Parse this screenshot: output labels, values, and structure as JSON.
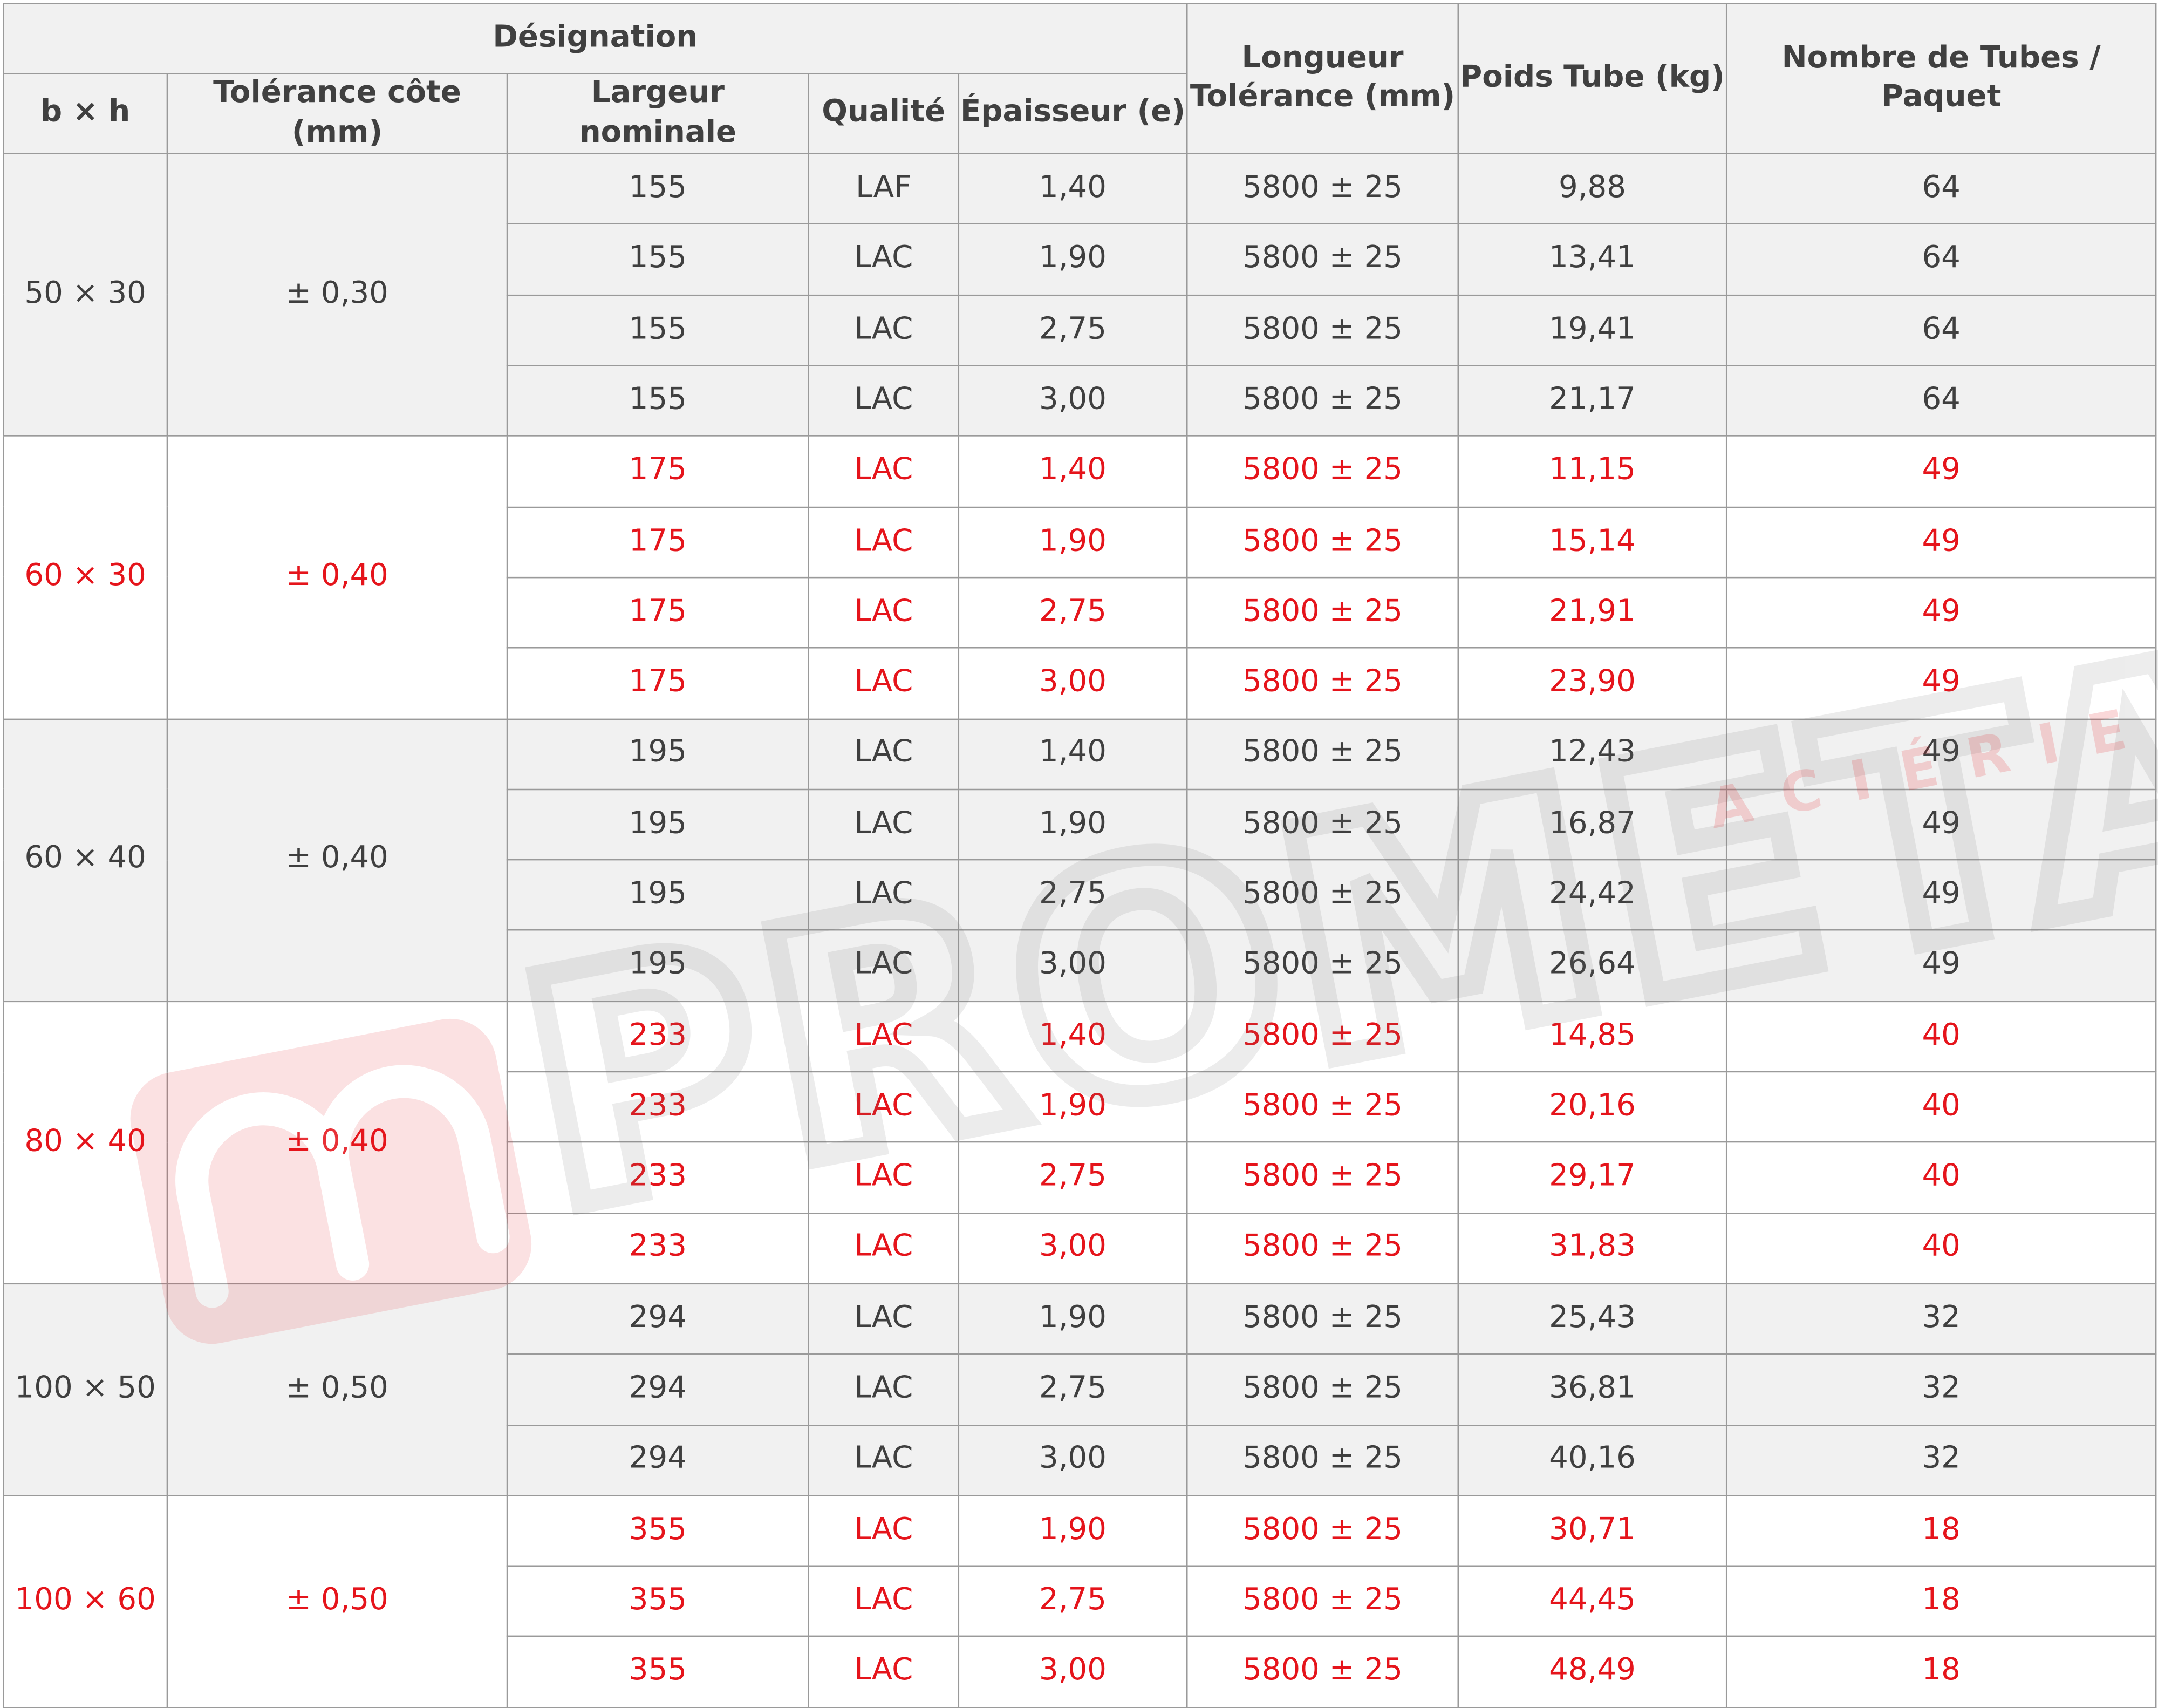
{
  "headers": {
    "designation": "Désignation",
    "bxh": "b × h",
    "tolerance_cote": "Tolérance côte (mm)",
    "largeur_nominale": "Largeur nominale",
    "qualite": "Qualité",
    "epaisseur": "Épaisseur (e)",
    "longueur_line1": "Longueur",
    "longueur_line2": "Tolérance (mm)",
    "poids": "Poids Tube (kg)",
    "nombre": "Nombre de Tubes / Paquet"
  },
  "groups": [
    {
      "bxh": "50 × 30",
      "tolerance": "± 0,30",
      "style": "gray",
      "rows": [
        {
          "largeur": "155",
          "qualite": "LAF",
          "epaisseur": "1,40",
          "longueur": "5800 ± 25",
          "poids": "9,88",
          "nombre": "64"
        },
        {
          "largeur": "155",
          "qualite": "LAC",
          "epaisseur": "1,90",
          "longueur": "5800 ± 25",
          "poids": "13,41",
          "nombre": "64"
        },
        {
          "largeur": "155",
          "qualite": "LAC",
          "epaisseur": "2,75",
          "longueur": "5800 ± 25",
          "poids": "19,41",
          "nombre": "64"
        },
        {
          "largeur": "155",
          "qualite": "LAC",
          "epaisseur": "3,00",
          "longueur": "5800 ± 25",
          "poids": "21,17",
          "nombre": "64"
        }
      ]
    },
    {
      "bxh": "60 × 30",
      "tolerance": "± 0,40",
      "style": "red",
      "rows": [
        {
          "largeur": "175",
          "qualite": "LAC",
          "epaisseur": "1,40",
          "longueur": "5800 ± 25",
          "poids": "11,15",
          "nombre": "49"
        },
        {
          "largeur": "175",
          "qualite": "LAC",
          "epaisseur": "1,90",
          "longueur": "5800 ± 25",
          "poids": "15,14",
          "nombre": "49"
        },
        {
          "largeur": "175",
          "qualite": "LAC",
          "epaisseur": "2,75",
          "longueur": "5800 ± 25",
          "poids": "21,91",
          "nombre": "49"
        },
        {
          "largeur": "175",
          "qualite": "LAC",
          "epaisseur": "3,00",
          "longueur": "5800 ± 25",
          "poids": "23,90",
          "nombre": "49"
        }
      ]
    },
    {
      "bxh": "60 × 40",
      "tolerance": "± 0,40",
      "style": "gray",
      "rows": [
        {
          "largeur": "195",
          "qualite": "LAC",
          "epaisseur": "1,40",
          "longueur": "5800 ± 25",
          "poids": "12,43",
          "nombre": "49"
        },
        {
          "largeur": "195",
          "qualite": "LAC",
          "epaisseur": "1,90",
          "longueur": "5800 ± 25",
          "poids": "16,87",
          "nombre": "49"
        },
        {
          "largeur": "195",
          "qualite": "LAC",
          "epaisseur": "2,75",
          "longueur": "5800 ± 25",
          "poids": "24,42",
          "nombre": "49"
        },
        {
          "largeur": "195",
          "qualite": "LAC",
          "epaisseur": "3,00",
          "longueur": "5800 ± 25",
          "poids": "26,64",
          "nombre": "49"
        }
      ]
    },
    {
      "bxh": "80 × 40",
      "tolerance": "± 0,40",
      "style": "red",
      "rows": [
        {
          "largeur": "233",
          "qualite": "LAC",
          "epaisseur": "1,40",
          "longueur": "5800 ± 25",
          "poids": "14,85",
          "nombre": "40"
        },
        {
          "largeur": "233",
          "qualite": "LAC",
          "epaisseur": "1,90",
          "longueur": "5800 ± 25",
          "poids": "20,16",
          "nombre": "40"
        },
        {
          "largeur": "233",
          "qualite": "LAC",
          "epaisseur": "2,75",
          "longueur": "5800 ± 25",
          "poids": "29,17",
          "nombre": "40"
        },
        {
          "largeur": "233",
          "qualite": "LAC",
          "epaisseur": "3,00",
          "longueur": "5800 ± 25",
          "poids": "31,83",
          "nombre": "40"
        }
      ]
    },
    {
      "bxh": "100 × 50",
      "tolerance": "± 0,50",
      "style": "gray",
      "rows": [
        {
          "largeur": "294",
          "qualite": "LAC",
          "epaisseur": "1,90",
          "longueur": "5800 ± 25",
          "poids": "25,43",
          "nombre": "32"
        },
        {
          "largeur": "294",
          "qualite": "LAC",
          "epaisseur": "2,75",
          "longueur": "5800 ± 25",
          "poids": "36,81",
          "nombre": "32"
        },
        {
          "largeur": "294",
          "qualite": "LAC",
          "epaisseur": "3,00",
          "longueur": "5800 ± 25",
          "poids": "40,16",
          "nombre": "32"
        }
      ]
    },
    {
      "bxh": "100 × 60",
      "tolerance": "± 0,50",
      "style": "red",
      "rows": [
        {
          "largeur": "355",
          "qualite": "LAC",
          "epaisseur": "1,90",
          "longueur": "5800 ± 25",
          "poids": "30,71",
          "nombre": "18"
        },
        {
          "largeur": "355",
          "qualite": "LAC",
          "epaisseur": "2,75",
          "longueur": "5800 ± 25",
          "poids": "44,45",
          "nombre": "18"
        },
        {
          "largeur": "355",
          "qualite": "LAC",
          "epaisseur": "3,00",
          "longueur": "5800 ± 25",
          "poids": "48,49",
          "nombre": "18"
        }
      ]
    }
  ],
  "watermark": {
    "brand": "PROMETAL",
    "sub": "ACIÉRIE",
    "logo_icon": "prometal-pm-logo-icon",
    "colors": {
      "logo": "#e5141b",
      "brand_text": "#9a9a9a"
    }
  },
  "colors": {
    "header_bg": "#f1f1f1",
    "gray_row_bg": "#f1f1f1",
    "red_text": "#e5141b",
    "body_text": "#3f3f3f",
    "border": "#9a9a9a"
  }
}
